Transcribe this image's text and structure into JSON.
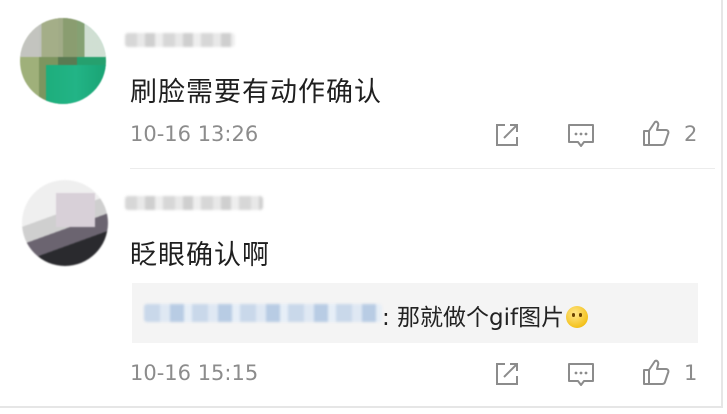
{
  "comments": [
    {
      "text": "刷脸需要有动作确认",
      "time": "10-16 13:26",
      "like_count": "2"
    },
    {
      "text": "眨眼确认啊",
      "time": "10-16 15:15",
      "like_count": "1",
      "reply": {
        "text": ": 那就做个gif图片",
        "emoji": "slight-smile-emoji"
      }
    }
  ],
  "icons": {
    "share": "share-icon",
    "comment": "comment-icon",
    "like": "thumbs-up-icon"
  },
  "colors": {
    "text": "#1f1f1f",
    "meta": "#8c8c8c",
    "reply_bg": "#f4f4f4"
  }
}
